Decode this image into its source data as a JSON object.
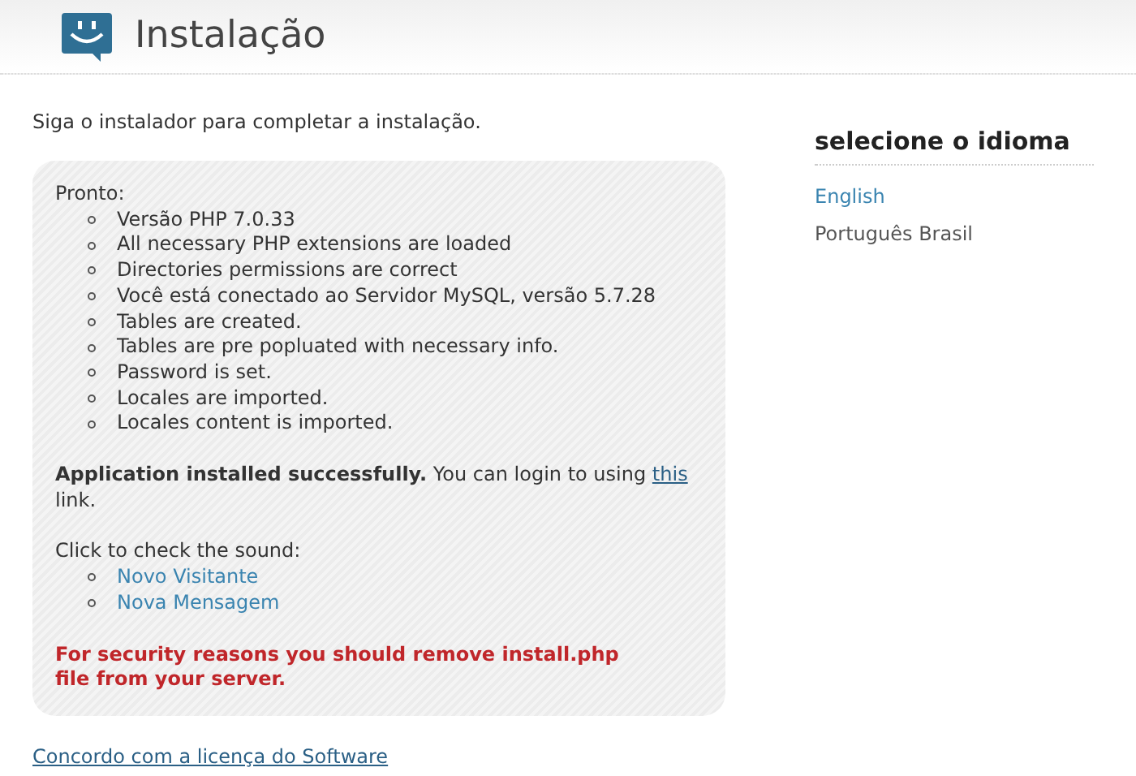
{
  "header": {
    "title": "Instalação"
  },
  "intro": "Siga o instalador para completar a instalação.",
  "status": {
    "heading": "Pronto:",
    "checks": [
      "Versão PHP 7.0.33",
      "All necessary PHP extensions are loaded",
      "Directories permissions are correct",
      "Você está conectado ao Servidor MySQL, versão 5.7.28",
      "Tables are created.",
      "Tables are pre popluated with necessary info.",
      "Password is set.",
      "Locales are imported.",
      "Locales content is imported."
    ],
    "success": {
      "text": "**Application installed successfully.** You can login to using ",
      "link": "this",
      "after": " link."
    },
    "sound_heading": "Click to check the sound:",
    "sounds": [
      "Novo Visitante",
      "Nova Mensagem"
    ],
    "warning": "For security reasons you should remove install.php file from your server."
  },
  "license_link": "Concordo com a licença do Software",
  "sidebar": {
    "title": "selecione o idioma",
    "languages": [
      {
        "label": "English",
        "selected": false
      },
      {
        "label": "Português Brasil",
        "selected": true
      }
    ]
  }
}
